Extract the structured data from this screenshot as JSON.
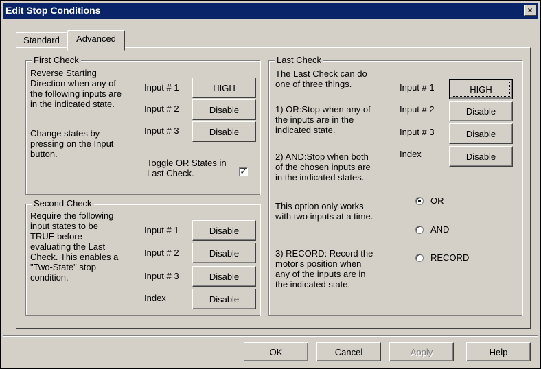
{
  "window": {
    "title": "Edit Stop Conditions",
    "close_glyph": "×"
  },
  "tabs": [
    {
      "label": "Standard",
      "selected": false
    },
    {
      "label": "Advanced",
      "selected": true
    }
  ],
  "first_check": {
    "legend": "First Check",
    "desc_lines": [
      "Reverse Starting",
      "Direction when any of",
      "the following inputs are",
      "in the indicated state."
    ],
    "help_lines": [
      "Change states by",
      "pressing on the Input",
      "button."
    ],
    "inputs": [
      {
        "label": "Input # 1",
        "state": "HIGH"
      },
      {
        "label": "Input # 2",
        "state": "Disable"
      },
      {
        "label": "Input # 3",
        "state": "Disable"
      }
    ],
    "toggle_lines": [
      "Toggle OR States in",
      "Last Check."
    ],
    "toggle_checked": true,
    "check_glyph": "✓"
  },
  "second_check": {
    "legend": "Second Check",
    "desc_lines": [
      "Require the following",
      "input states to be",
      "TRUE before",
      "evaluating the Last",
      "Check.  This enables a",
      "\"Two-State\" stop",
      "condition."
    ],
    "inputs": [
      {
        "label": "Input # 1",
        "state": "Disable"
      },
      {
        "label": "Input # 2",
        "state": "Disable"
      },
      {
        "label": "Input # 3",
        "state": "Disable"
      },
      {
        "label": "Index",
        "state": "Disable"
      }
    ]
  },
  "last_check": {
    "legend": "Last Check",
    "intro_lines": [
      "The Last Check can do",
      "one of three things."
    ],
    "or_lines": [
      "1) OR:Stop when any of",
      "the inputs are in the",
      "indicated state."
    ],
    "and_lines": [
      "2) AND:Stop when both",
      "of the chosen inputs are",
      "in the indicated states."
    ],
    "note_lines": [
      "This option only works",
      "with two inputs at a time."
    ],
    "record_lines": [
      "3) RECORD:  Record the",
      "motor's position when",
      "any of the inputs are in",
      "the indicated state."
    ],
    "inputs": [
      {
        "label": "Input # 1",
        "state": "HIGH"
      },
      {
        "label": "Input # 2",
        "state": "Disable"
      },
      {
        "label": "Input # 3",
        "state": "Disable"
      },
      {
        "label": "Index",
        "state": "Disable"
      }
    ],
    "modes": [
      {
        "label": "OR",
        "selected": true
      },
      {
        "label": "AND",
        "selected": false
      },
      {
        "label": "RECORD",
        "selected": false
      }
    ]
  },
  "footer": {
    "ok": "OK",
    "cancel": "Cancel",
    "apply": "Apply",
    "help": "Help"
  }
}
